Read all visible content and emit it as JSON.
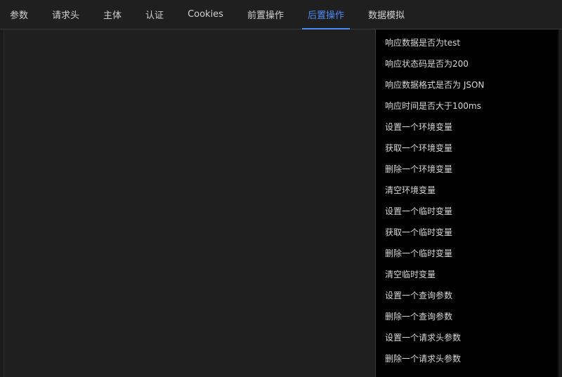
{
  "tabs": [
    {
      "label": "参数"
    },
    {
      "label": "请求头"
    },
    {
      "label": "主体"
    },
    {
      "label": "认证"
    },
    {
      "label": "Cookies"
    },
    {
      "label": "前置操作"
    },
    {
      "label": "后置操作",
      "active": true
    },
    {
      "label": "数据模拟"
    }
  ],
  "colors": {
    "accent": "#4d8bf5",
    "background": "#1b1b1b",
    "panel_background": "#000000"
  },
  "snippets": [
    "响应数据是否为test",
    "响应状态码是否为200",
    "响应数据格式是否为 JSON",
    "响应时间是否大于100ms",
    "设置一个环境变量",
    "获取一个环境变量",
    "删除一个环境变量",
    "清空环境变量",
    "设置一个临时变量",
    "获取一个临时变量",
    "删除一个临时变量",
    "清空临时变量",
    "设置一个查询参数",
    "删除一个查询参数",
    "设置一个请求头参数",
    "删除一个请求头参数"
  ]
}
